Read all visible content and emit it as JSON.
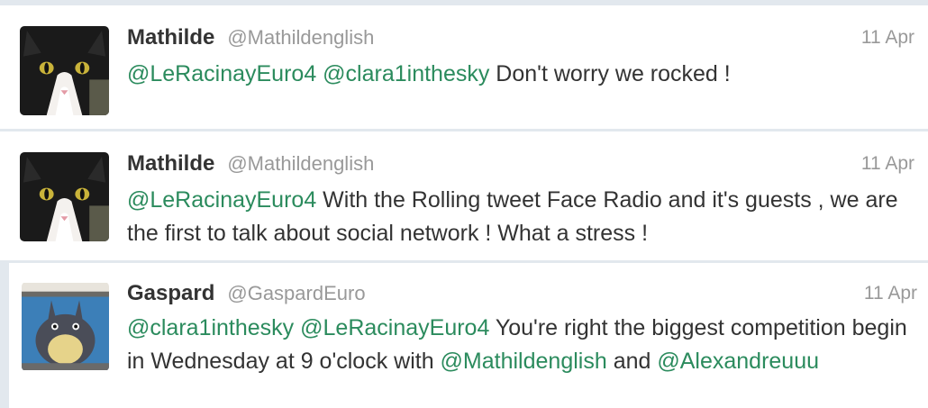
{
  "tweets": [
    {
      "name": "Mathilde",
      "handle": "@Mathildenglish",
      "time": "11 Apr",
      "avatar_icon": "cat-avatar",
      "segments": [
        {
          "text": "@LeRacinayEuro4",
          "mention": true
        },
        {
          "text": " ",
          "mention": false
        },
        {
          "text": "@clara1inthesky",
          "mention": true
        },
        {
          "text": " Don't worry we rocked !",
          "mention": false
        }
      ]
    },
    {
      "name": "Mathilde",
      "handle": "@Mathildenglish",
      "time": "11 Apr",
      "avatar_icon": "cat-avatar",
      "segments": [
        {
          "text": "@LeRacinayEuro4",
          "mention": true
        },
        {
          "text": " With the Rolling tweet Face Radio and it's guests , we are the first to talk about social network ! What a stress !",
          "mention": false
        }
      ]
    },
    {
      "name": "Gaspard",
      "handle": "@GaspardEuro",
      "time": "11 Apr",
      "avatar_icon": "totoro-avatar",
      "segments": [
        {
          "text": "@clara1inthesky",
          "mention": true
        },
        {
          "text": " ",
          "mention": false
        },
        {
          "text": "@LeRacinayEuro4",
          "mention": true
        },
        {
          "text": " You're right the biggest competition begin in Wednesday at 9 o'clock with ",
          "mention": false
        },
        {
          "text": "@Mathildenglish",
          "mention": true
        },
        {
          "text": " and ",
          "mention": false
        },
        {
          "text": "@Alexandreuuu",
          "mention": true
        }
      ]
    }
  ],
  "colors": {
    "mention": "#2b8b5d",
    "name": "#333333",
    "meta": "#999999",
    "background": "#e2e8ee"
  }
}
